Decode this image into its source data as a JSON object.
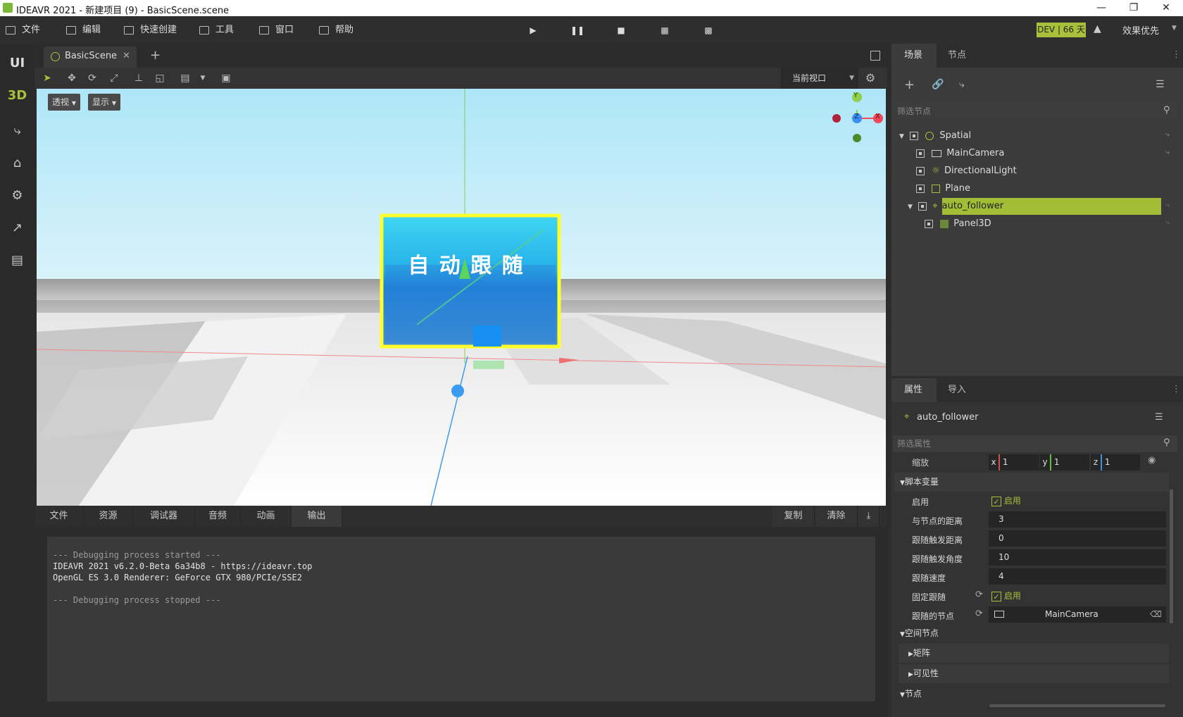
{
  "window": {
    "title": "IDEAVR 2021 - 新建项目 (9) - BasicScene.scene"
  },
  "menu": {
    "items": [
      "文件",
      "编辑",
      "快速创建",
      "工具",
      "窗口",
      "帮助"
    ],
    "dev_badge": "DEV | 66 天",
    "quality": "效果优先"
  },
  "left_bar": {
    "ui": "UI",
    "three_d": "3D"
  },
  "scene_tab": {
    "label": "BasicScene",
    "add": "+"
  },
  "toolbar3d": {
    "viewport_select": "当前视口"
  },
  "viewport": {
    "perspective_btn": "透视",
    "display_btn": "显示",
    "panel_text": "自 动 跟 随",
    "gizmo": {
      "y": "Y",
      "x": "X",
      "z": "Z"
    }
  },
  "bottom_tabs": [
    "文件",
    "资源",
    "调试器",
    "音频",
    "动画",
    "输出"
  ],
  "bottom_actions": {
    "copy": "复制",
    "clear": "清除"
  },
  "console_lines": [
    "--- Debugging process started ---",
    "IDEAVR 2021 v6.2.0-Beta 6a34b8 - https://ideavr.top",
    "OpenGL ES 3.0 Renderer: GeForce GTX 980/PCIe/SSE2",
    "",
    "--- Debugging process stopped ---"
  ],
  "scene_panel": {
    "tabs": [
      "场景",
      "节点"
    ],
    "filter_placeholder": "筛选节点",
    "tree": [
      {
        "label": "Spatial",
        "icon": "spatial-icon"
      },
      {
        "label": "MainCamera",
        "icon": "camera-icon"
      },
      {
        "label": "DirectionalLight",
        "icon": "light-icon"
      },
      {
        "label": "Plane",
        "icon": "plane-icon"
      },
      {
        "label": "auto_follower",
        "icon": "spatial-icon",
        "selected": true
      },
      {
        "label": "Panel3D",
        "icon": "panel-icon"
      }
    ]
  },
  "inspector": {
    "tabs": [
      "属性",
      "导入"
    ],
    "node_name": "auto_follower",
    "filter_placeholder": "筛选属性",
    "scale": {
      "label": "缩放",
      "x_axis": "x",
      "y_axis": "y",
      "z_axis": "z",
      "x": "1",
      "y": "1",
      "z": "1"
    },
    "script_section": "脚本变量",
    "props": [
      {
        "label": "启用",
        "value": "启用",
        "type": "checkbox"
      },
      {
        "label": "与节点的距离",
        "value": "3"
      },
      {
        "label": "跟随触发距离",
        "value": "0"
      },
      {
        "label": "跟随触发角度",
        "value": "10"
      },
      {
        "label": "跟随速度",
        "value": "4"
      },
      {
        "label": "固定跟随",
        "value": "启用",
        "type": "checkbox"
      },
      {
        "label": "跟随的节点",
        "value": "MainCamera",
        "type": "node"
      }
    ],
    "spatial_section": "空间节点",
    "matrix_section": "矩阵",
    "visibility_section": "可见性",
    "node_section": "节点"
  },
  "colors": {
    "accent": "#a8c03a",
    "selected": "#a3bd37"
  }
}
